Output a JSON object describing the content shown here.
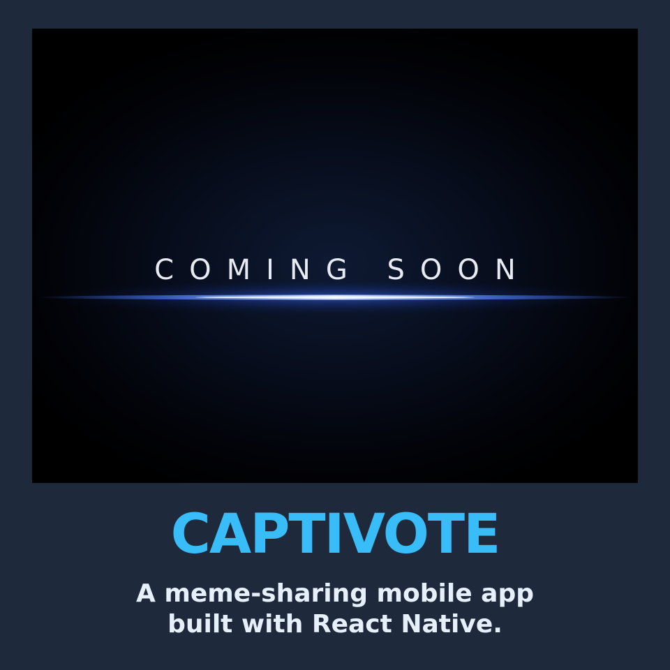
{
  "preview": {
    "banner_text": "COMING SOON"
  },
  "app": {
    "name": "CAPTIVOTE",
    "tagline_line1": "A meme-sharing mobile app",
    "tagline_line2": "built with React Native."
  },
  "colors": {
    "page_background": "#1e293b",
    "title": "#38bdf8",
    "tagline": "#e6f0fa",
    "glow": "#4a7dff"
  }
}
